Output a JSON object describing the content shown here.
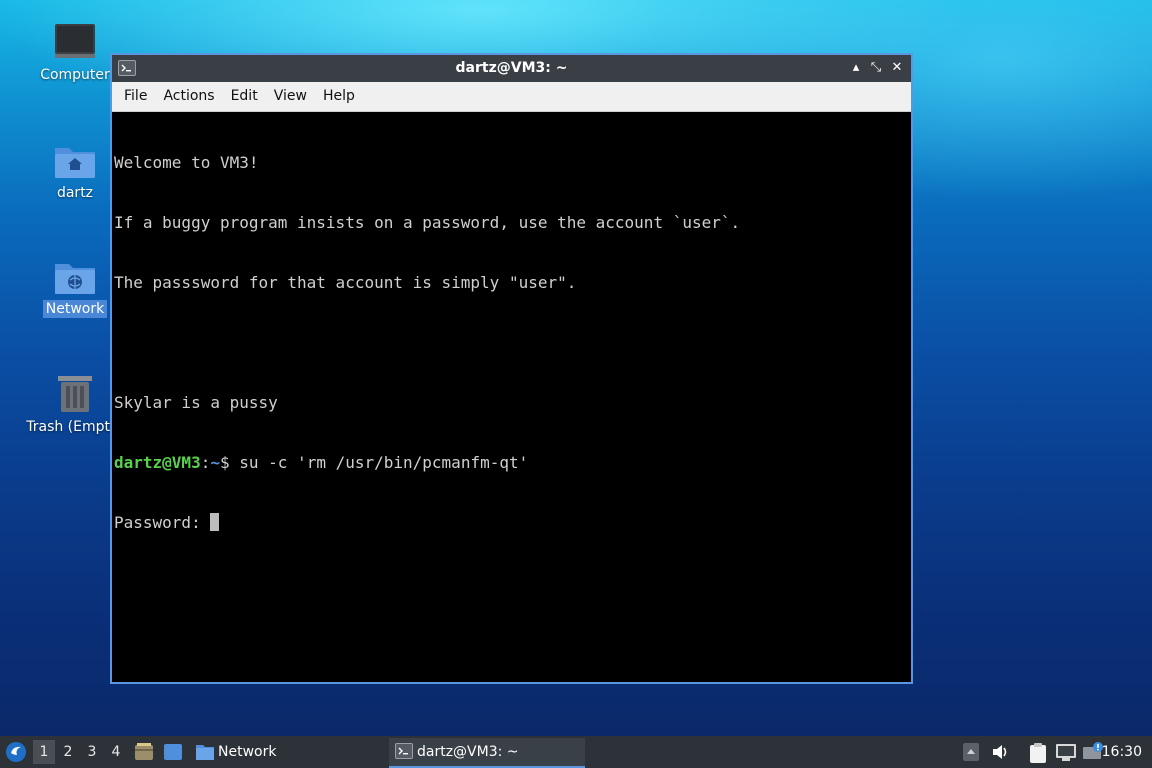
{
  "desktop": {
    "icons": [
      {
        "label": "Computer"
      },
      {
        "label": "dartz"
      },
      {
        "label": "Network"
      },
      {
        "label": "Trash (Empty)"
      }
    ]
  },
  "window": {
    "title": "dartz@VM3: ~",
    "controls": {
      "minimize": "▴",
      "maximize": "⤡",
      "close": "✕"
    },
    "menu": [
      "File",
      "Actions",
      "Edit",
      "View",
      "Help"
    ]
  },
  "terminal": {
    "lines": [
      "Welcome to VM3!",
      "If a buggy program insists on a password, use the account `user`.",
      "The passsword for that account is simply \"user\".",
      "",
      "Skylar is a pussy"
    ],
    "prompt": {
      "user_host": "dartz@VM3",
      "sep": ":",
      "path": "~",
      "symbol": "$",
      "command": " su -c 'rm /usr/bin/pcmanfm-qt'"
    },
    "password_prompt": "Password: "
  },
  "taskbar": {
    "workspaces": [
      "1",
      "2",
      "3",
      "4"
    ],
    "active_workspace": "1",
    "tasks": [
      {
        "label": "Network"
      },
      {
        "label": "dartz@VM3: ~"
      }
    ],
    "clock": "16:30"
  },
  "colors": {
    "window_border": "#5a97e0",
    "prompt_user": "#58d14c",
    "prompt_path": "#5b8fdc",
    "taskbar_bg": "#2d3238"
  }
}
